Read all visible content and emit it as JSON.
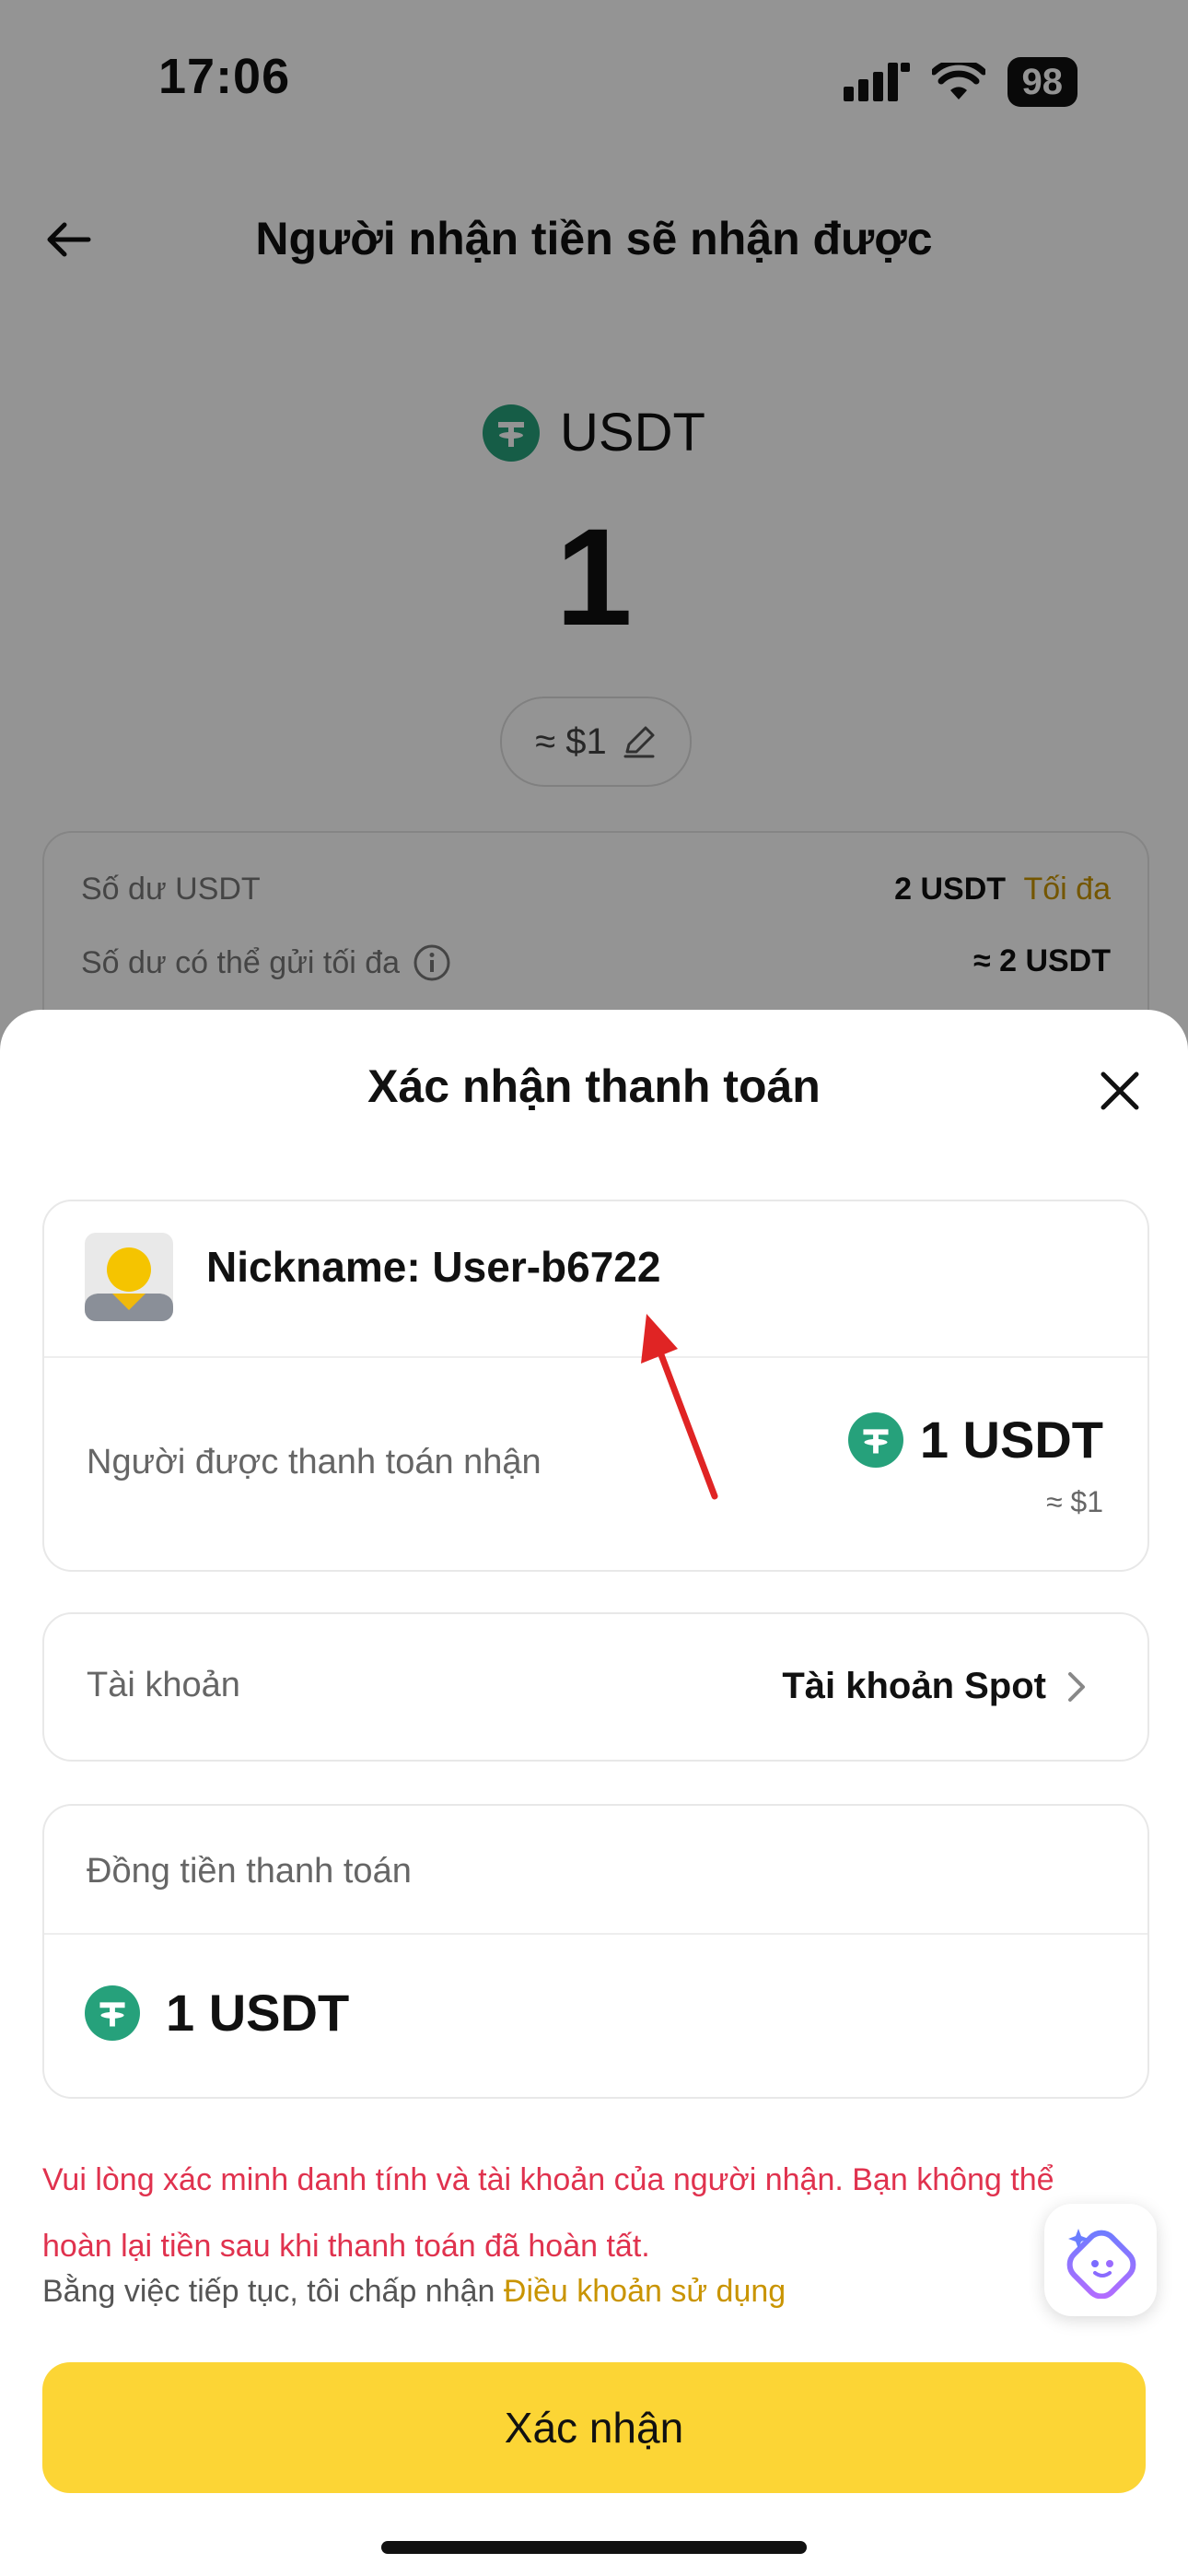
{
  "status_bar": {
    "time": "17:06",
    "battery": "98"
  },
  "header": {
    "title": "Người nhận tiền sẽ nhận được"
  },
  "asset": {
    "symbol": "USDT",
    "amount": "1",
    "approx": "≈ $1"
  },
  "balance": {
    "label": "Số dư USDT",
    "value": "2 USDT",
    "max_link": "Tối đa",
    "sendable_label": "Số dư có thể gửi tối đa",
    "sendable_value": "≈ 2 USDT"
  },
  "sheet": {
    "title": "Xác nhận thanh toán",
    "nickname": "Nickname: User-b6722",
    "payee_label": "Người được thanh toán nhận",
    "payee_amount": "1 USDT",
    "payee_approx": "≈ $1",
    "account_label": "Tài khoản",
    "account_value": "Tài khoản Spot",
    "currency_label": "Đồng tiền thanh toán",
    "currency_amount": "1 USDT",
    "warning": "Vui lòng xác minh danh tính và tài khoản của người nhận. Bạn không thể hoàn lại tiền sau khi thanh toán đã hoàn tất.",
    "terms_prefix": "Bằng việc tiếp tục, tôi chấp nhận ",
    "terms_link": "Điều khoản sử dụng",
    "confirm_label": "Xác nhận"
  },
  "colors": {
    "accent": "#fcd535",
    "link": "#c99400",
    "warning": "#e0324e",
    "tether": "#26a17b"
  }
}
